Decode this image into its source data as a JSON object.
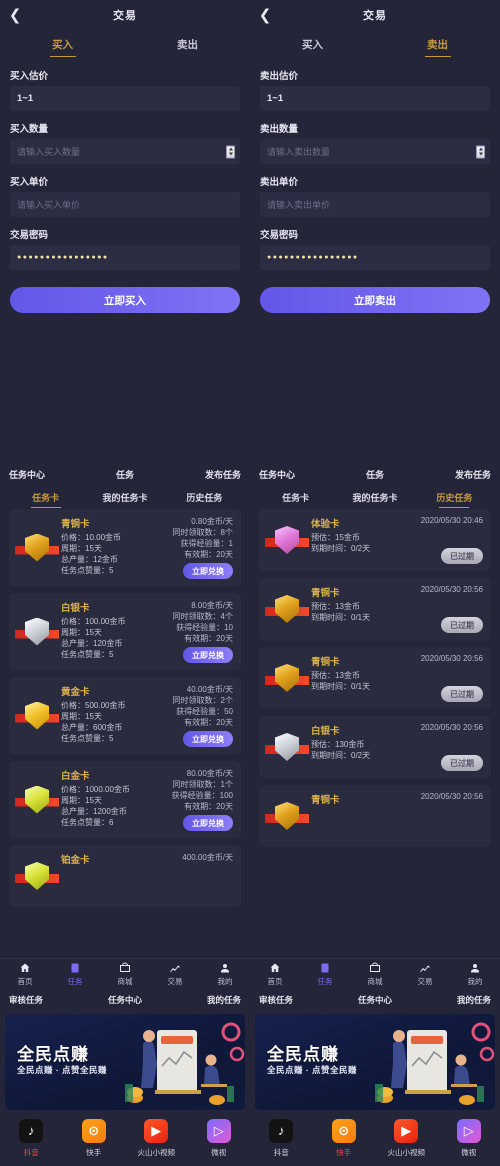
{
  "colors": {
    "bg": "#25253a",
    "card": "#2b2b40",
    "accent_gold": "#c79a3e",
    "accent_purple": "#7a6df2",
    "active_red": "#e5503a"
  },
  "left": {
    "trade": {
      "back_icon": "chevron-left-icon",
      "title": "交易",
      "tabs": [
        {
          "label": "买入",
          "active": true
        },
        {
          "label": "卖出",
          "active": false
        }
      ],
      "fields": [
        {
          "label": "买入估价",
          "value": "1~1",
          "placeholder": "",
          "spinner": false
        },
        {
          "label": "买入数量",
          "value": "",
          "placeholder": "请输入买入数量",
          "spinner": true
        },
        {
          "label": "买入单价",
          "value": "",
          "placeholder": "请输入买入单价",
          "spinner": false
        },
        {
          "label": "交易密码",
          "value": "●●●●●●●●●●●●●●●●",
          "placeholder": "",
          "spinner": false
        }
      ],
      "submit_label": "立即买入"
    },
    "task": {
      "top_nav": [
        "任务中心",
        "任务",
        "发布任务"
      ],
      "tabs": [
        {
          "label": "任务卡",
          "active": true
        },
        {
          "label": "我的任务卡",
          "active": false
        },
        {
          "label": "历史任务",
          "active": false
        }
      ],
      "cards": [
        {
          "name": "青铜卡",
          "shield": "bronze",
          "lines": [
            "价格：10.00金币",
            "周期：15天",
            "总产量：12金币",
            "任务点赞量：5"
          ],
          "right": [
            "0.80金币/天",
            "同时领取数：8个",
            "获得经验量：1",
            "有效期：20天"
          ],
          "button": "立即兑换"
        },
        {
          "name": "白银卡",
          "shield": "silver",
          "lines": [
            "价格：100.00金币",
            "周期：15天",
            "总产量：120金币",
            "任务点赞量：5"
          ],
          "right": [
            "8.00金币/天",
            "同时领取数：4个",
            "获得经验量：10",
            "有效期：20天"
          ],
          "button": "立即兑换"
        },
        {
          "name": "黄金卡",
          "shield": "gold",
          "lines": [
            "价格：500.00金币",
            "周期：15天",
            "总产量：600金币",
            "任务点赞量：5"
          ],
          "right": [
            "40.00金币/天",
            "同时领取数：2个",
            "获得经验量：50",
            "有效期：20天"
          ],
          "button": "立即兑换"
        },
        {
          "name": "白金卡",
          "shield": "plat",
          "lines": [
            "价格：1000.00金币",
            "周期：15天",
            "总产量：1200金币",
            "任务点赞量：6"
          ],
          "right": [
            "80.00金币/天",
            "同时领取数：1个",
            "获得经验量：100",
            "有效期：20天"
          ],
          "button": "立即兑换"
        },
        {
          "name": "铂金卡",
          "shield": "plat",
          "lines": [],
          "right": [
            "400.00金币/天"
          ],
          "button": ""
        }
      ]
    },
    "bottom_nav": [
      {
        "label": "首页",
        "icon": "home-icon",
        "active": false
      },
      {
        "label": "任务",
        "icon": "task-icon",
        "active": true
      },
      {
        "label": "商城",
        "icon": "shop-icon",
        "active": false
      },
      {
        "label": "交易",
        "icon": "chart-icon",
        "active": false
      },
      {
        "label": "我的",
        "icon": "user-icon",
        "active": false
      }
    ],
    "sub_nav": [
      "审核任务",
      "任务中心",
      "我的任务"
    ],
    "banner": {
      "title": "全民点赚",
      "subtitle": "全民点赚 · 点赞全民赚"
    },
    "dock": [
      {
        "label": "抖音",
        "icon": "douyin-icon",
        "active": true
      },
      {
        "label": "快手",
        "icon": "kuaishou-icon",
        "active": false
      },
      {
        "label": "火山小视频",
        "icon": "huoshan-icon",
        "active": false
      },
      {
        "label": "微视",
        "icon": "weishi-icon",
        "active": false
      }
    ]
  },
  "right": {
    "trade": {
      "back_icon": "chevron-left-icon",
      "title": "交易",
      "tabs": [
        {
          "label": "买入",
          "active": false
        },
        {
          "label": "卖出",
          "active": true
        }
      ],
      "fields": [
        {
          "label": "卖出估价",
          "value": "1~1",
          "placeholder": "",
          "spinner": false
        },
        {
          "label": "卖出数量",
          "value": "",
          "placeholder": "请输入卖出数量",
          "spinner": true
        },
        {
          "label": "卖出单价",
          "value": "",
          "placeholder": "请输入卖出单价",
          "spinner": false
        },
        {
          "label": "交易密码",
          "value": "●●●●●●●●●●●●●●●●",
          "placeholder": "",
          "spinner": false
        }
      ],
      "submit_label": "立即卖出"
    },
    "task": {
      "top_nav": [
        "任务中心",
        "任务",
        "发布任务"
      ],
      "tabs": [
        {
          "label": "任务卡",
          "active": false
        },
        {
          "label": "我的任务卡",
          "active": false
        },
        {
          "label": "历史任务",
          "active": true
        }
      ],
      "cards": [
        {
          "name": "体验卡",
          "shield": "exp",
          "lines": [
            "预估：15金币",
            "到期时间：0/2天"
          ],
          "date": "2020/05/30 20:46",
          "button": "已过期"
        },
        {
          "name": "青铜卡",
          "shield": "bronze",
          "lines": [
            "预估：13金币",
            "到期时间：0/1天"
          ],
          "date": "2020/05/30 20:56",
          "button": "已过期"
        },
        {
          "name": "青铜卡",
          "shield": "bronze",
          "lines": [
            "预估：13金币",
            "到期时间：0/1天"
          ],
          "date": "2020/05/30 20:56",
          "button": "已过期"
        },
        {
          "name": "白银卡",
          "shield": "silver",
          "lines": [
            "预估：130金币",
            "到期时间：0/2天"
          ],
          "date": "2020/05/30 20:56",
          "button": "已过期"
        },
        {
          "name": "青铜卡",
          "shield": "bronze",
          "lines": [],
          "date": "2020/05/30 20:56",
          "button": ""
        }
      ]
    },
    "bottom_nav": [
      {
        "label": "首页",
        "icon": "home-icon",
        "active": false
      },
      {
        "label": "任务",
        "icon": "task-icon",
        "active": true
      },
      {
        "label": "商城",
        "icon": "shop-icon",
        "active": false
      },
      {
        "label": "交易",
        "icon": "chart-icon",
        "active": false
      },
      {
        "label": "我的",
        "icon": "user-icon",
        "active": false
      }
    ],
    "sub_nav": [
      "审核任务",
      "任务中心",
      "我的任务"
    ],
    "banner": {
      "title": "全民点赚",
      "subtitle": "全民点赚 · 点赞全民赚"
    },
    "dock": [
      {
        "label": "抖音",
        "icon": "douyin-icon",
        "active": false
      },
      {
        "label": "快手",
        "icon": "kuaishou-icon",
        "active": true
      },
      {
        "label": "火山小视频",
        "icon": "huoshan-icon",
        "active": false
      },
      {
        "label": "微视",
        "icon": "weishi-icon",
        "active": false
      }
    ]
  }
}
